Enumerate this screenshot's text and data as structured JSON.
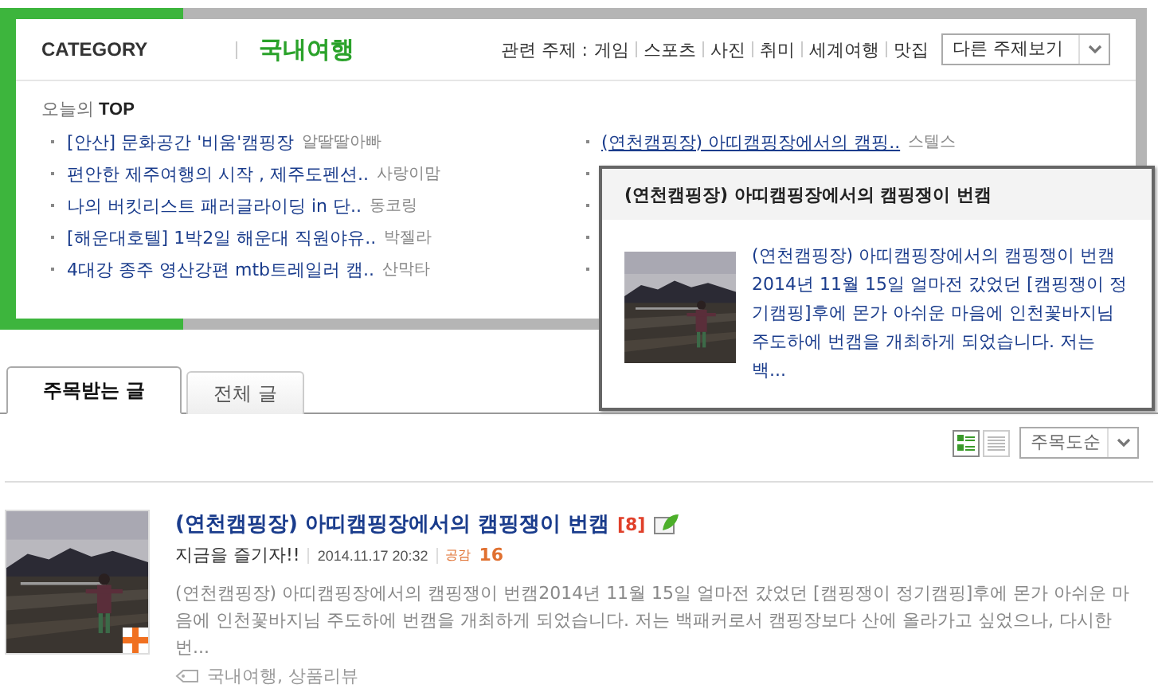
{
  "category": {
    "label": "CATEGORY",
    "name": "국내여행"
  },
  "related": {
    "label": "관련 주제 :",
    "items": [
      "게임",
      "스포츠",
      "사진",
      "취미",
      "세계여행",
      "맛집"
    ]
  },
  "topic_dropdown": {
    "value": "다른 주제보기"
  },
  "top": {
    "prefix": "오늘의",
    "heading": "TOP",
    "left": [
      {
        "title": "[안산] 문화공간 '비움'캠핑장",
        "author": "알딸딸아빠"
      },
      {
        "title": "편안한 제주여행의 시작 , 제주도펜션..",
        "author": "사랑이맘"
      },
      {
        "title": "나의 버킷리스트 패러글라이딩 in 단..",
        "author": "동코링"
      },
      {
        "title": "[해운대호텔] 1박2일 해운대 직원야유..",
        "author": "박젤라"
      },
      {
        "title": "4대강 종주 영산강편 mtb트레일러 캠..",
        "author": "산막타"
      }
    ],
    "right": [
      {
        "title": "(연천캠핑장) 아띠캠핑장에서의 캠핑..",
        "author": "스텔스",
        "hovered": true
      }
    ]
  },
  "popup": {
    "title": "(연천캠핑장) 아띠캠핑장에서의 캠핑쟁이 번캠",
    "text": "(연천캠핑장) 아띠캠핑장에서의 캠핑쟁이 번캠2014년 11월 15일 얼마전 갔었던 [캠핑쟁이 정기캠핑]후에 몬가 아쉬운 마음에 인천꽃바지님 주도하에 번캠을 개최하게 되었습니다. 저는 백..."
  },
  "tabs": [
    {
      "label": "주목받는 글",
      "selected": true
    },
    {
      "label": "전체 글",
      "selected": false
    }
  ],
  "view_modes": [
    {
      "kind": "thumbnail",
      "selected": true
    },
    {
      "kind": "list",
      "selected": false
    }
  ],
  "sort_dropdown": {
    "value": "주목도순"
  },
  "posts": [
    {
      "title": "(연천캠핑장) 아띠캠핑장에서의 캠핑쟁이 번캠",
      "comments": "[8]",
      "author": "지금을 즐기자!!",
      "date": "2014.11.17 20:32",
      "likes_label": "공감",
      "likes": "16",
      "summary": "(연천캠핑장) 아띠캠핑장에서의 캠핑쟁이 번캠2014년 11월 15일 얼마전 갔었던 [캠핑쟁이 정기캠핑]후에 몬가 아쉬운 마음에 인천꽃바지님 주도하에 번캠을 개최하게 되었습니다. 저는 백패커로서 캠핑장보다 산에 올라가고 싶었으나, 다시한번...",
      "tags": "국내여행, 상품리뷰"
    }
  ]
}
